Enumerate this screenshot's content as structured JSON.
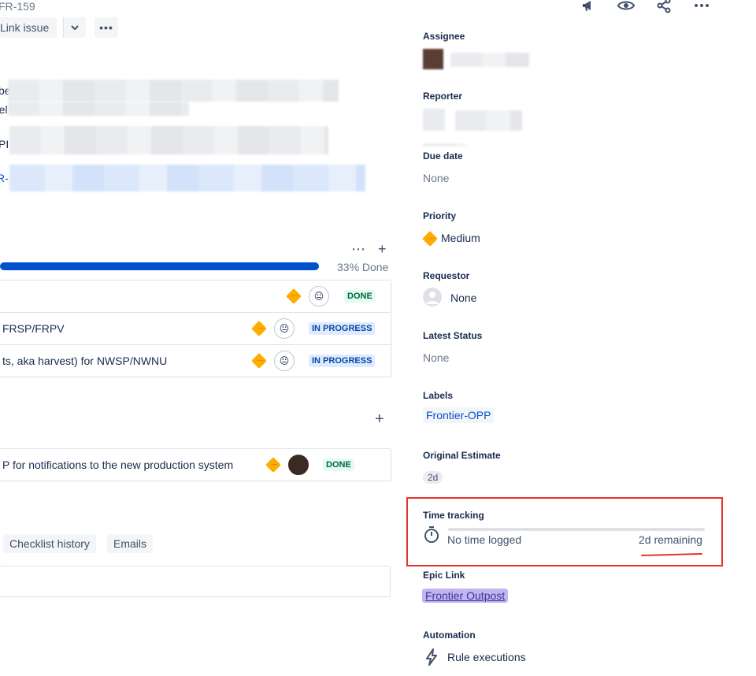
{
  "header": {
    "issue_key": "FR-159",
    "link_issue_label": "Link issue",
    "more_label": "•••",
    "icons": [
      "megaphone-icon",
      "eye-icon",
      "share-icon",
      "more-icon"
    ]
  },
  "details": {
    "fragments": [
      "be",
      "rel",
      "PI",
      "R-"
    ]
  },
  "child_issues": {
    "progress_percent": 33,
    "progress_text": "33% Done",
    "rows": [
      {
        "text": "",
        "status": "DONE"
      },
      {
        "text": "FRSP/FRPV",
        "status": "IN PROGRESS"
      },
      {
        "text": "ts, aka harvest) for NWSP/NWNU",
        "status": "IN PROGRESS"
      }
    ]
  },
  "linked_issues": {
    "rows": [
      {
        "text": "P for notifications to the new production system",
        "status": "DONE"
      }
    ]
  },
  "activity_tabs": [
    "Checklist history",
    "Emails"
  ],
  "sidebar": {
    "assignee_label": "Assignee",
    "reporter_label": "Reporter",
    "due_date_label": "Due date",
    "due_date_value": "None",
    "priority_label": "Priority",
    "priority_value": "Medium",
    "requestor_label": "Requestor",
    "requestor_value": "None",
    "latest_status_label": "Latest Status",
    "latest_status_value": "None",
    "labels_label": "Labels",
    "labels_value": "Frontier-OPP",
    "original_estimate_label": "Original Estimate",
    "original_estimate_value": "2d",
    "time_tracking_label": "Time tracking",
    "time_logged": "No time logged",
    "time_remaining": "2d remaining",
    "epic_link_label": "Epic Link",
    "epic_link_value": "Frontier Outpost",
    "automation_label": "Automation",
    "automation_value": "Rule executions"
  },
  "colors": {
    "accent": "#0052cc",
    "priority": "#ffab00",
    "annotation": "#e5332a",
    "epic": "#c0b6f2"
  }
}
